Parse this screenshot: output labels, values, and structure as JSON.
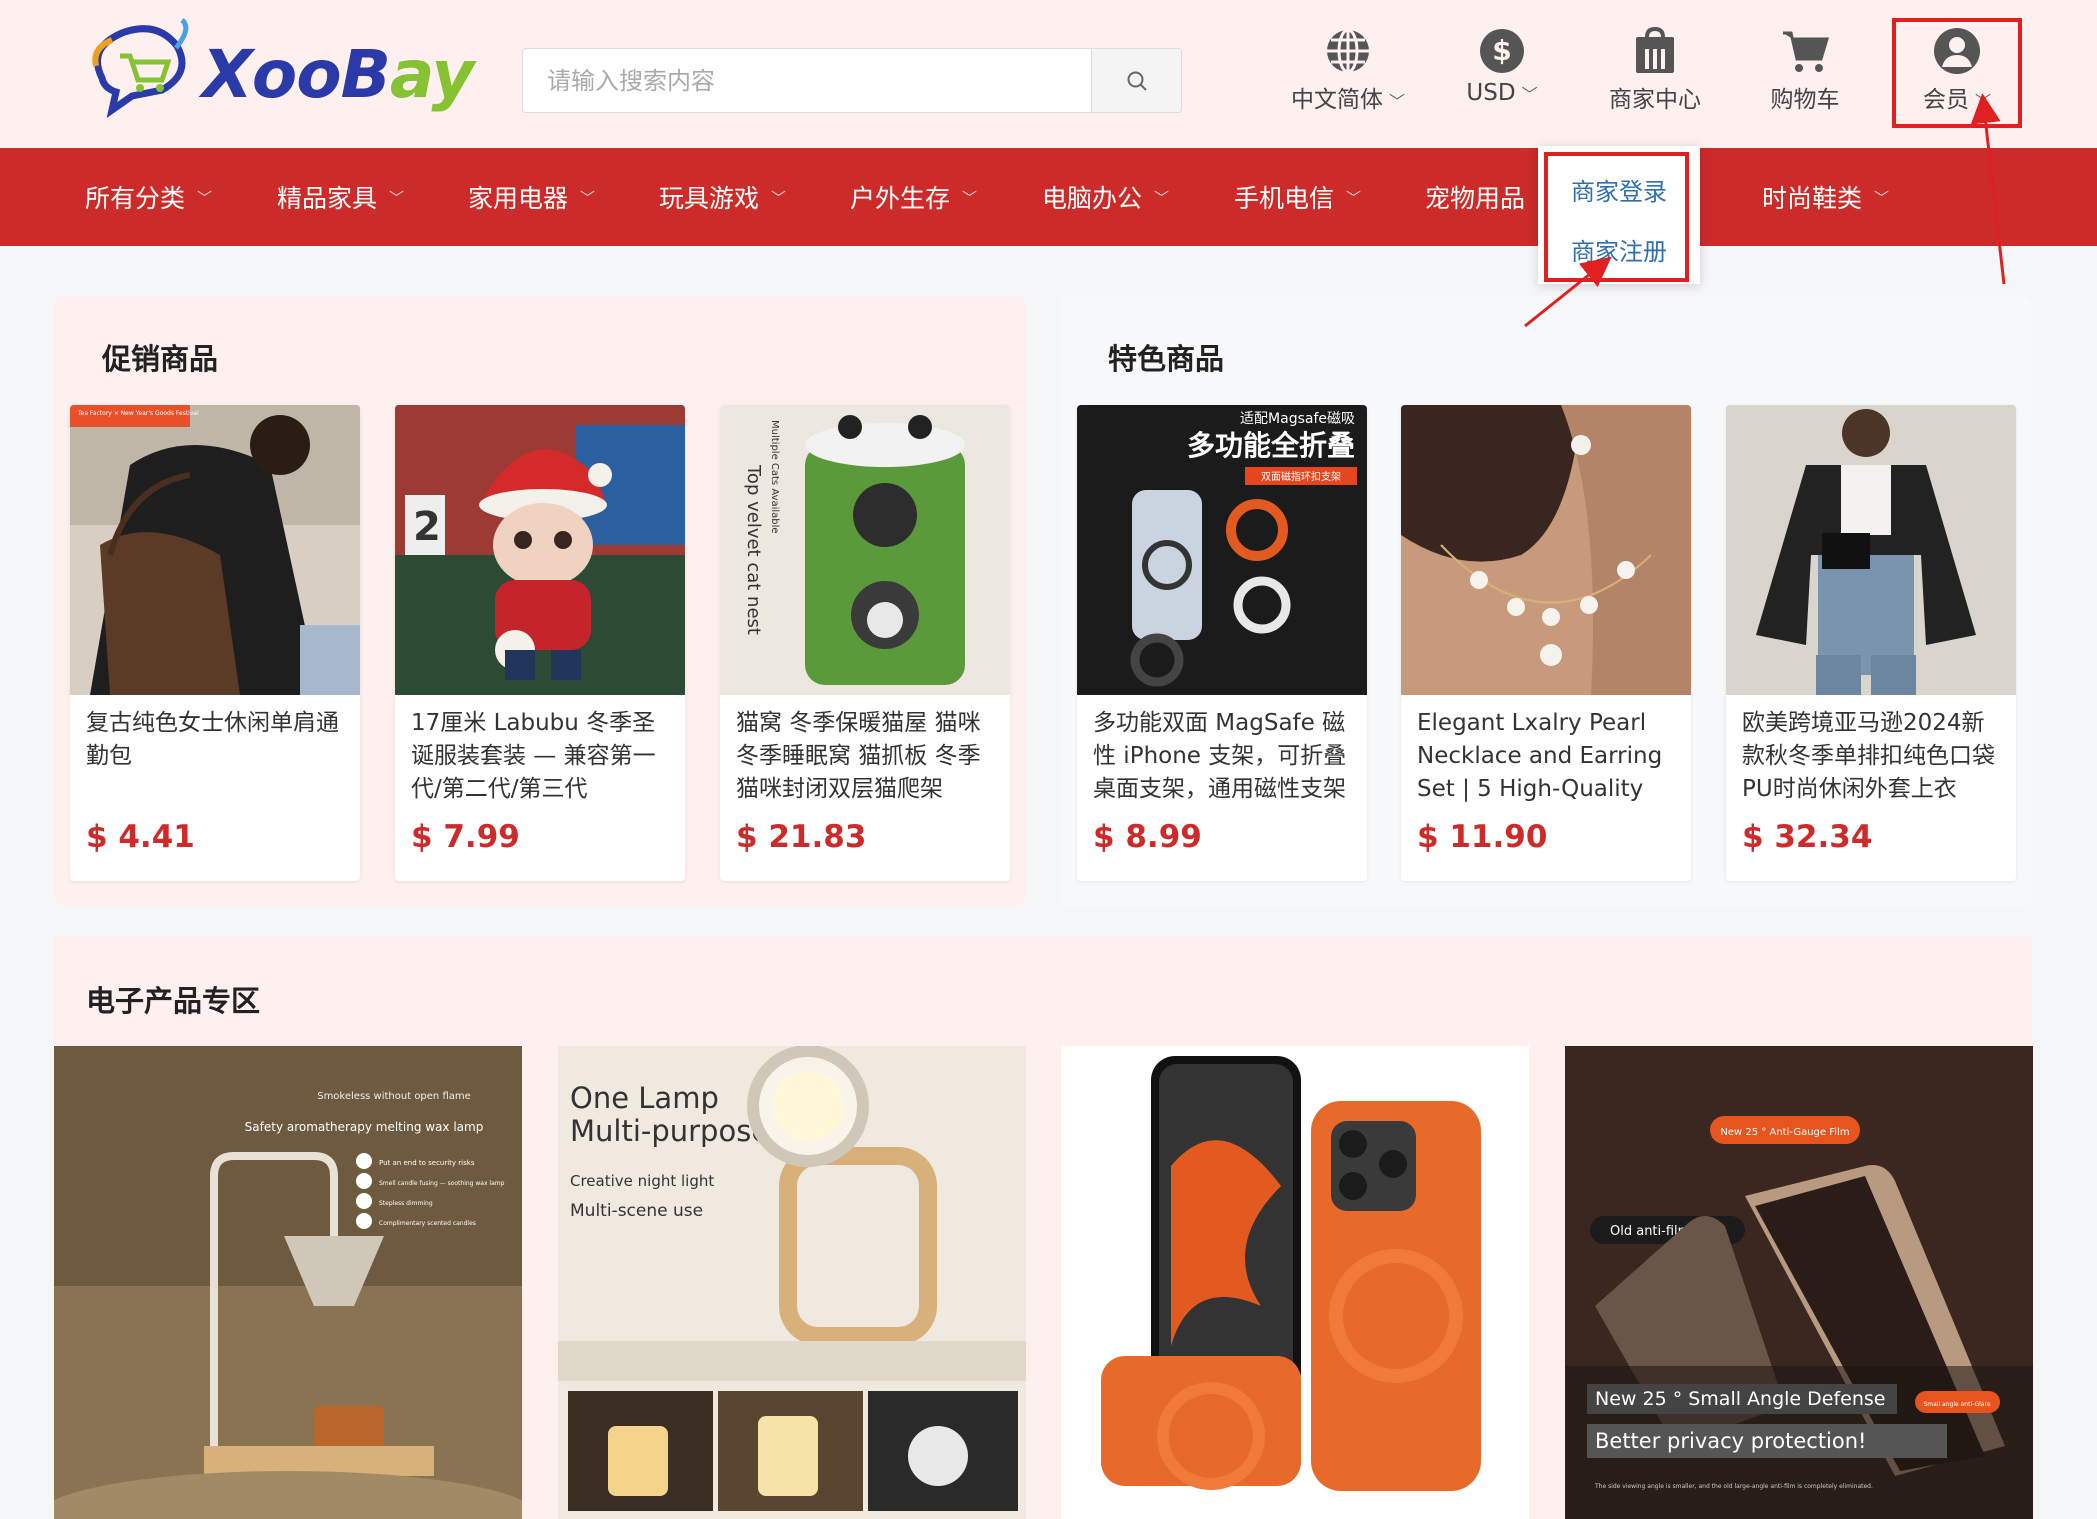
{
  "header": {
    "logo": {
      "x": "X",
      "oo": "oo",
      "b": "B",
      "ay": "ay"
    },
    "search": {
      "placeholder": "请输入搜索内容"
    },
    "language": {
      "label": "中文简体"
    },
    "currency": {
      "label": "USD"
    },
    "merchant_center": {
      "label": "商家中心"
    },
    "cart": {
      "label": "购物车"
    },
    "member": {
      "label": "会员"
    }
  },
  "merchant_menu": {
    "items": [
      {
        "label": "商家登录"
      },
      {
        "label": "商家注册"
      }
    ]
  },
  "categories": [
    {
      "label": "所有分类"
    },
    {
      "label": "精品家具"
    },
    {
      "label": "家用电器"
    },
    {
      "label": "玩具游戏"
    },
    {
      "label": "户外生存"
    },
    {
      "label": "电脑办公"
    },
    {
      "label": "手机电信"
    },
    {
      "label": "宠物用品"
    },
    {
      "label": "时尚鞋类"
    }
  ],
  "promo": {
    "title": "促销商品",
    "products": [
      {
        "name": "复古纯色女士休闲单肩通勤包",
        "price": "$ 4.41",
        "badge": "Tea Factory × New Year's Goods Festival"
      },
      {
        "name": "17厘米 Labubu 冬季圣诞服装套装 — 兼容第一代/第二代/第三代",
        "price": "$ 7.99"
      },
      {
        "name": "猫窝 冬季保暖猫屋 猫咪冬季睡眠窝 猫抓板 冬季猫咪封闭双层猫爬架",
        "price": "$ 21.83",
        "overlay1": "Top velvet cat nest",
        "overlay2": "Multiple Cats Available"
      }
    ]
  },
  "featured": {
    "title": "特色商品",
    "products": [
      {
        "name": "多功能双面 MagSafe 磁性 iPhone 支架，可折叠桌面支架，通用磁性支架",
        "price": "$ 8.99",
        "overlay1": "适配Magsafe磁吸",
        "overlay2": "多功能全折叠",
        "overlay3": "双面磁指环扣支架"
      },
      {
        "name": "Elegant Lxalry Pearl Necklace and Earring Set | 5 High-Quality",
        "price": "$ 11.90"
      },
      {
        "name": "欧美跨境亚马逊2024新款秋冬季单排扣纯色口袋PU时尚休闲外套上衣",
        "price": "$ 32.34"
      }
    ]
  },
  "electronics": {
    "title": "电子产品专区",
    "items": [
      {
        "lines": [
          "Smokeless without open flame",
          "Safety aromatherapy melting wax lamp",
          "Put an end to security risks",
          "Smell candle fusing — soothing wax lamp",
          "Stepless dimming",
          "Complimentary scented candles"
        ]
      },
      {
        "lines": [
          "One Lamp",
          "Multi-purpose",
          "Creative night light",
          "Multi-scene use"
        ]
      },
      {
        "lines": []
      },
      {
        "lines": [
          "New 25 ° Anti-Gauge Film",
          "Old anti-film",
          "New 25 ° Small Angle Defense",
          "Better privacy protection!",
          "Small angle anti-Glare",
          "The side viewing angle is smaller, and the old large-angle anti-film is completely eliminated."
        ]
      }
    ]
  },
  "colors": {
    "brand_red": "#cd2a2a",
    "header_bg": "#fdf0ee",
    "link_blue": "#2f6fb0",
    "highlight": "#e02020"
  }
}
